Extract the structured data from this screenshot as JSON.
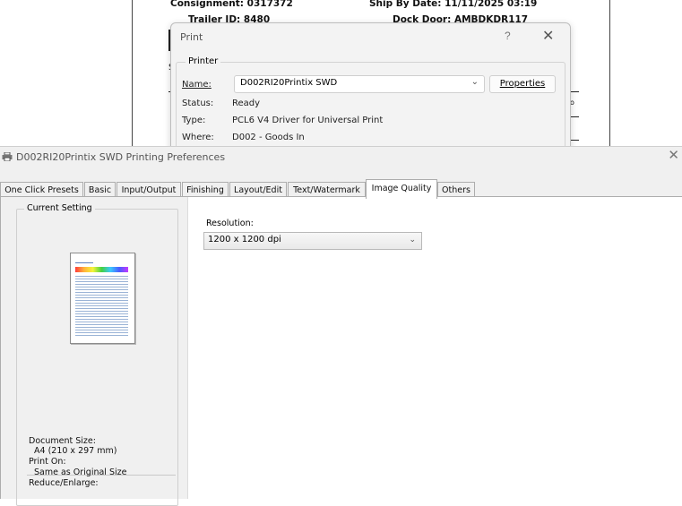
{
  "background_doc": {
    "consignment": "Consignment: 0317372",
    "ship_by": "Ship By Date: 11/11/2025 03:19",
    "trailer": "Trailer ID: 8480",
    "dock": "Dock Door: AMBDKDR117",
    "stub_s": "S",
    "stub_o": "o"
  },
  "print_dialog": {
    "title": "Print",
    "help": "?",
    "close": "✕",
    "printer_group": "Printer",
    "name_label": "Name:",
    "name_value": "D002RI20Printix SWD",
    "properties": "Properties",
    "status_label": "Status:",
    "status_value": "Ready",
    "type_label": "Type:",
    "type_value": "PCL6 V4 Driver for Universal Print",
    "where_label": "Where:",
    "where_value": "D002 - Goods In"
  },
  "preferences": {
    "title": "D002RI20Printix SWD Printing Preferences",
    "close": "✕",
    "tabs": [
      {
        "label": "One Click Presets"
      },
      {
        "label": "Basic"
      },
      {
        "label": "Input/Output"
      },
      {
        "label": "Finishing"
      },
      {
        "label": "Layout/Edit"
      },
      {
        "label": "Text/Watermark"
      },
      {
        "label": "Image Quality"
      },
      {
        "label": "Others"
      }
    ],
    "active_tab": "Image Quality",
    "current_setting": "Current Setting",
    "document_size_label": "Document Size:",
    "document_size_value": "A4 (210 x 297 mm)",
    "print_on_label": "Print On:",
    "print_on_value": "Same as Original Size",
    "reduce_label": "Reduce/Enlarge:",
    "resolution_label": "Resolution:",
    "resolution_value": "1200 x 1200 dpi"
  }
}
